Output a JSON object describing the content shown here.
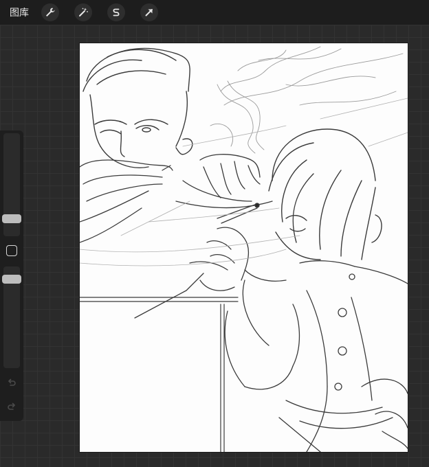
{
  "topbar": {
    "gallery_label": "图库",
    "tools": [
      {
        "icon": "wrench-icon",
        "name": "actions"
      },
      {
        "icon": "magic-wand-icon",
        "name": "adjustments"
      },
      {
        "icon": "selection-s-icon",
        "name": "selection"
      },
      {
        "icon": "arrow-cursor-icon",
        "name": "transform"
      }
    ]
  },
  "sidebar": {
    "controls": [
      "brush-size-slider",
      "modify-button",
      "opacity-slider",
      "undo-icon",
      "redo-icon"
    ]
  },
  "colors": {
    "topbar_bg": "#1d1d1d",
    "workspace_bg": "#2a2a2a",
    "canvas_bg": "#fdfdfd",
    "sketch_stroke": "#3a3a3a"
  }
}
